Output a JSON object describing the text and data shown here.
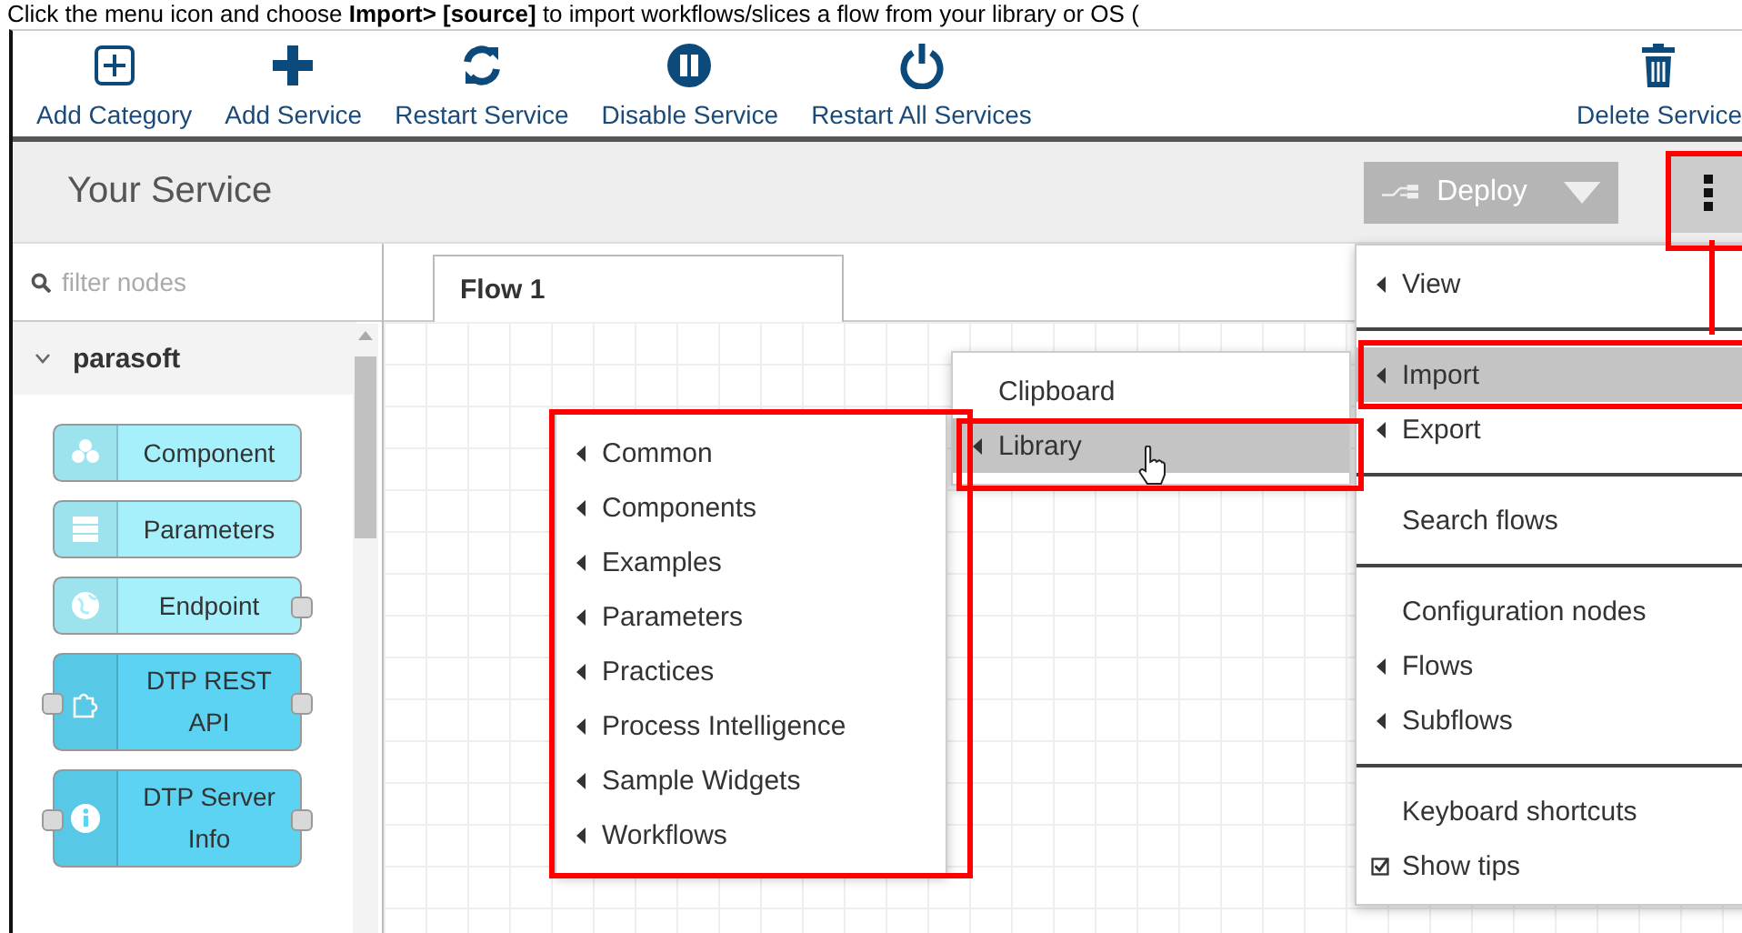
{
  "caption": "Click the menu icon and choose **Import> [source]** to import workflows/slices a flow from your library or OS (",
  "toolbar": {
    "buttons": [
      {
        "label": "Add Category",
        "kind": "add-box"
      },
      {
        "label": "Add Service",
        "kind": "plus"
      },
      {
        "label": "Restart Service",
        "kind": "refresh"
      },
      {
        "label": "Disable Service",
        "kind": "pause"
      },
      {
        "label": "Restart All Services",
        "kind": "power"
      },
      {
        "label": "Delete Service",
        "kind": "trash"
      }
    ]
  },
  "header": {
    "title": "Your Service",
    "deploy": {
      "label": "Deploy",
      "disabled": true
    }
  },
  "palette": {
    "filter": {
      "placeholder": "filter nodes"
    },
    "category": {
      "label": "parasoft",
      "expanded": true
    },
    "nodes": [
      {
        "label": "Component",
        "kind": "light",
        "input": false,
        "output": false
      },
      {
        "label": "Parameters",
        "kind": "light",
        "input": false,
        "output": false
      },
      {
        "label": "Endpoint",
        "kind": "light",
        "input": false,
        "output": true
      },
      {
        "label": "DTP REST API",
        "kind": "dark",
        "input": true,
        "output": true
      },
      {
        "label": "DTP Server Info",
        "kind": "dark",
        "input": true,
        "output": true
      }
    ]
  },
  "tabs": [
    {
      "label": "Flow 1",
      "selected": true
    }
  ],
  "main_menu": [
    {
      "kind": "submenu",
      "label": "View",
      "selected": false
    },
    {
      "kind": "separator"
    },
    {
      "kind": "submenu",
      "label": "Import",
      "selected": true
    },
    {
      "kind": "submenu",
      "label": "Export",
      "selected": false
    },
    {
      "kind": "separator"
    },
    {
      "kind": "action",
      "label": "Search flows",
      "selected": false
    },
    {
      "kind": "separator"
    },
    {
      "kind": "action",
      "label": "Configuration nodes",
      "selected": false
    },
    {
      "kind": "submenu",
      "label": "Flows",
      "selected": false
    },
    {
      "kind": "submenu",
      "label": "Subflows",
      "selected": false
    },
    {
      "kind": "separator"
    },
    {
      "kind": "action",
      "label": "Keyboard shortcuts",
      "selected": false
    },
    {
      "kind": "toggle",
      "label": "Show tips",
      "checked": true,
      "selected": false
    }
  ],
  "import_menu": [
    {
      "kind": "action",
      "label": "Clipboard",
      "selected": false
    },
    {
      "kind": "submenu",
      "label": "Library",
      "selected": true
    }
  ],
  "library_menu": [
    {
      "kind": "submenu",
      "label": "Common",
      "selected": false
    },
    {
      "kind": "submenu",
      "label": "Components",
      "selected": false
    },
    {
      "kind": "submenu",
      "label": "Examples",
      "selected": false
    },
    {
      "kind": "submenu",
      "label": "Parameters",
      "selected": false
    },
    {
      "kind": "submenu",
      "label": "Practices",
      "selected": false
    },
    {
      "kind": "submenu",
      "label": "Process Intelligence",
      "selected": false
    },
    {
      "kind": "submenu",
      "label": "Sample Widgets",
      "selected": false
    },
    {
      "kind": "submenu",
      "label": "Workflows",
      "selected": false
    }
  ]
}
